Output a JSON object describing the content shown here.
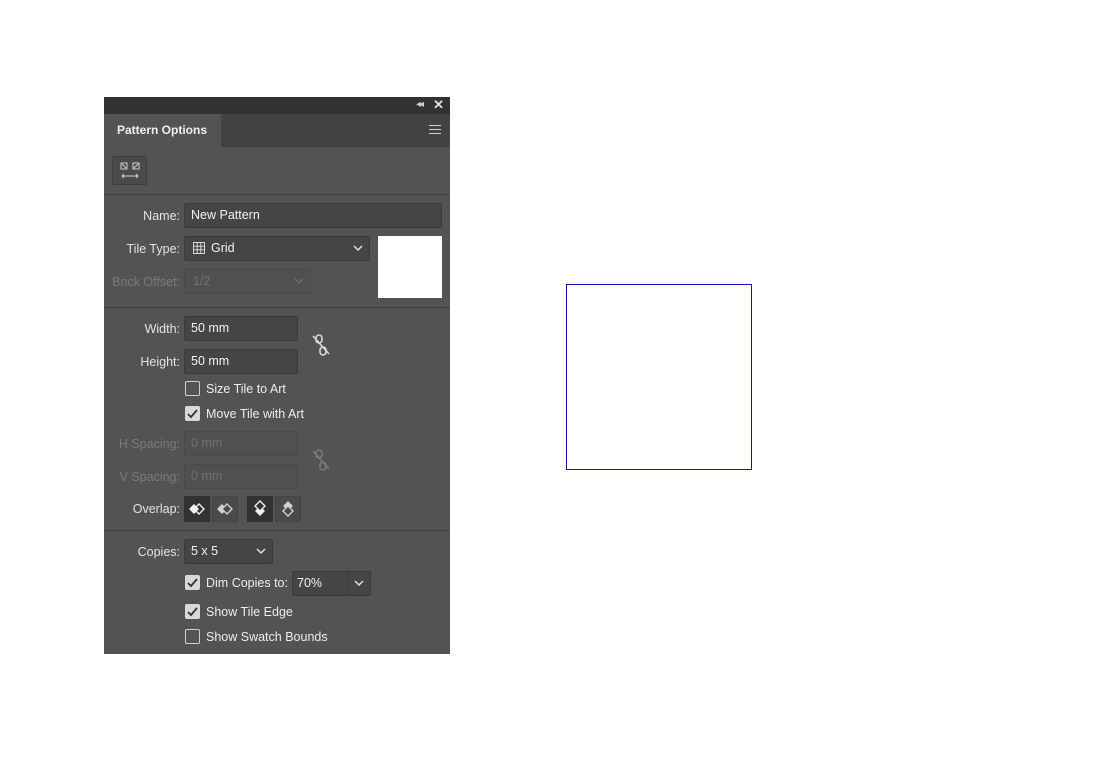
{
  "panel": {
    "tab_title": "Pattern Options",
    "name_label": "Name:",
    "name_value": "New Pattern",
    "tile_type_label": "Tile Type:",
    "tile_type_value": "Grid",
    "brick_offset_label": "Brick Offset:",
    "brick_offset_value": "1/2",
    "width_label": "Width:",
    "width_value": "50 mm",
    "height_label": "Height:",
    "height_value": "50 mm",
    "size_tile_to_art": {
      "label": "Size Tile to Art",
      "checked": false
    },
    "move_tile_with_art": {
      "label": "Move Tile with Art",
      "checked": true
    },
    "h_spacing_label": "H Spacing:",
    "h_spacing_value": "0 mm",
    "v_spacing_label": "V Spacing:",
    "v_spacing_value": "0 mm",
    "overlap_label": "Overlap:",
    "copies_label": "Copies:",
    "copies_value": "5 x 5",
    "dim_copies": {
      "label": "Dim Copies to:",
      "checked": true,
      "value": "70%"
    },
    "show_tile_edge": {
      "label": "Show Tile Edge",
      "checked": true
    },
    "show_swatch_bounds": {
      "label": "Show Swatch Bounds",
      "checked": false
    }
  },
  "icons": {
    "collapse": "double-chevron-left-icon",
    "close": "close-icon",
    "menu": "hamburger-menu-icon",
    "fit": "pattern-tile-tool-icon",
    "grid": "grid-icon",
    "link": "broken-link-icon"
  },
  "colors": {
    "panel_bg": "#535353",
    "titlebar_bg": "#323232",
    "tile_edge": "#1414a8"
  }
}
